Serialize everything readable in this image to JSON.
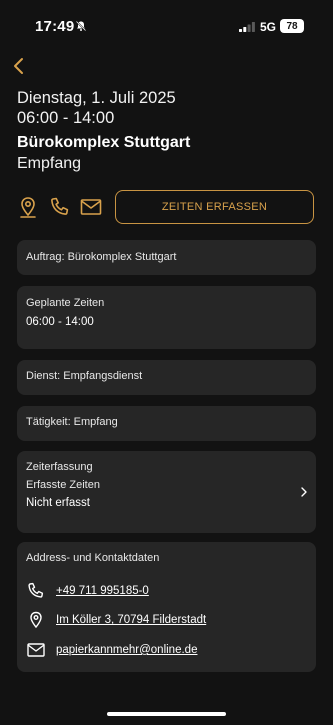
{
  "status_bar": {
    "time": "17:49",
    "network": "5G",
    "battery": "78"
  },
  "header": {
    "date": "Dienstag, 1. Juli 2025",
    "time_range": "06:00 - 14:00",
    "location": "Bürokomplex Stuttgart",
    "area": "Empfang"
  },
  "actions": {
    "record_times_label": "ZEITEN ERFASSEN"
  },
  "cards": {
    "auftrag": "Auftrag: Bürokomplex Stuttgart",
    "geplante_zeiten_label": "Geplante Zeiten",
    "geplante_zeiten_value": "06:00 - 14:00",
    "dienst": "Dienst: Empfangsdienst",
    "taetigkeit": "Tätigkeit: Empfang",
    "zeiterfassung_label": "Zeiterfassung",
    "erfasste_zeiten_label": "Erfasste Zeiten",
    "erfasste_zeiten_value": "Nicht erfasst"
  },
  "contact": {
    "title": "Address- und Kontaktdaten",
    "phone": "+49 711 995185-0",
    "address": "Im Köller 3, 70794 Filderstadt",
    "email": "papierkannmehr@online.de"
  },
  "colors": {
    "background": "#121212",
    "card": "#262626",
    "accent": "#d9a24c"
  },
  "icons": [
    "bell-off-icon",
    "signal-icon",
    "chevron-left-icon",
    "location-pin-icon",
    "phone-icon",
    "mail-icon",
    "chevron-right-icon"
  ]
}
